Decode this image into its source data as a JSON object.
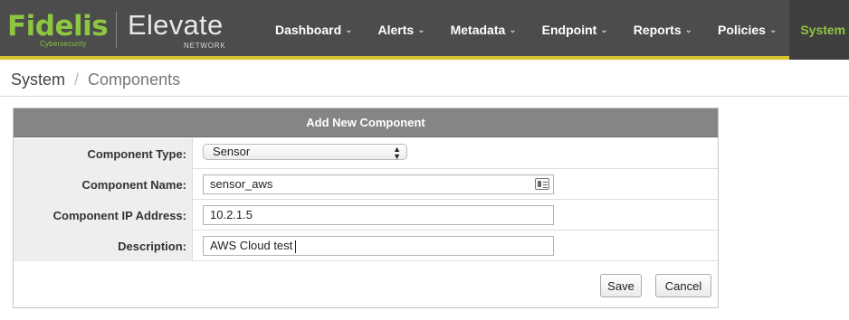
{
  "brand": {
    "logo_word": "Fidelis",
    "logo_sub": "Cybersecurity",
    "product": "Elevate",
    "product_sub": "NETWORK"
  },
  "nav": {
    "items": [
      {
        "label": "Dashboard"
      },
      {
        "label": "Alerts"
      },
      {
        "label": "Metadata"
      },
      {
        "label": "Endpoint"
      },
      {
        "label": "Reports"
      },
      {
        "label": "Policies"
      },
      {
        "label": "System"
      }
    ],
    "active": "System"
  },
  "breadcrumb": {
    "root": "System",
    "separator": "/",
    "current": "Components"
  },
  "form": {
    "title": "Add New Component",
    "component_type": {
      "label": "Component Type:",
      "value": "Sensor"
    },
    "component_name": {
      "label": "Component Name:",
      "value": "sensor_aws"
    },
    "component_ip": {
      "label": "Component IP Address:",
      "value": "10.2.1.5"
    },
    "description": {
      "label": "Description:",
      "value": "AWS Cloud test"
    },
    "save_label": "Save",
    "cancel_label": "Cancel"
  },
  "colors": {
    "topbar": "#4c4c4c",
    "accent_green": "#8dc63f",
    "accent_bar": "#d6c42e",
    "panel_header": "#858585"
  },
  "icons": {
    "chevron": "chevron-down-icon",
    "select_arrows": "updown-arrows-icon",
    "contact_card": "contact-card-icon"
  }
}
